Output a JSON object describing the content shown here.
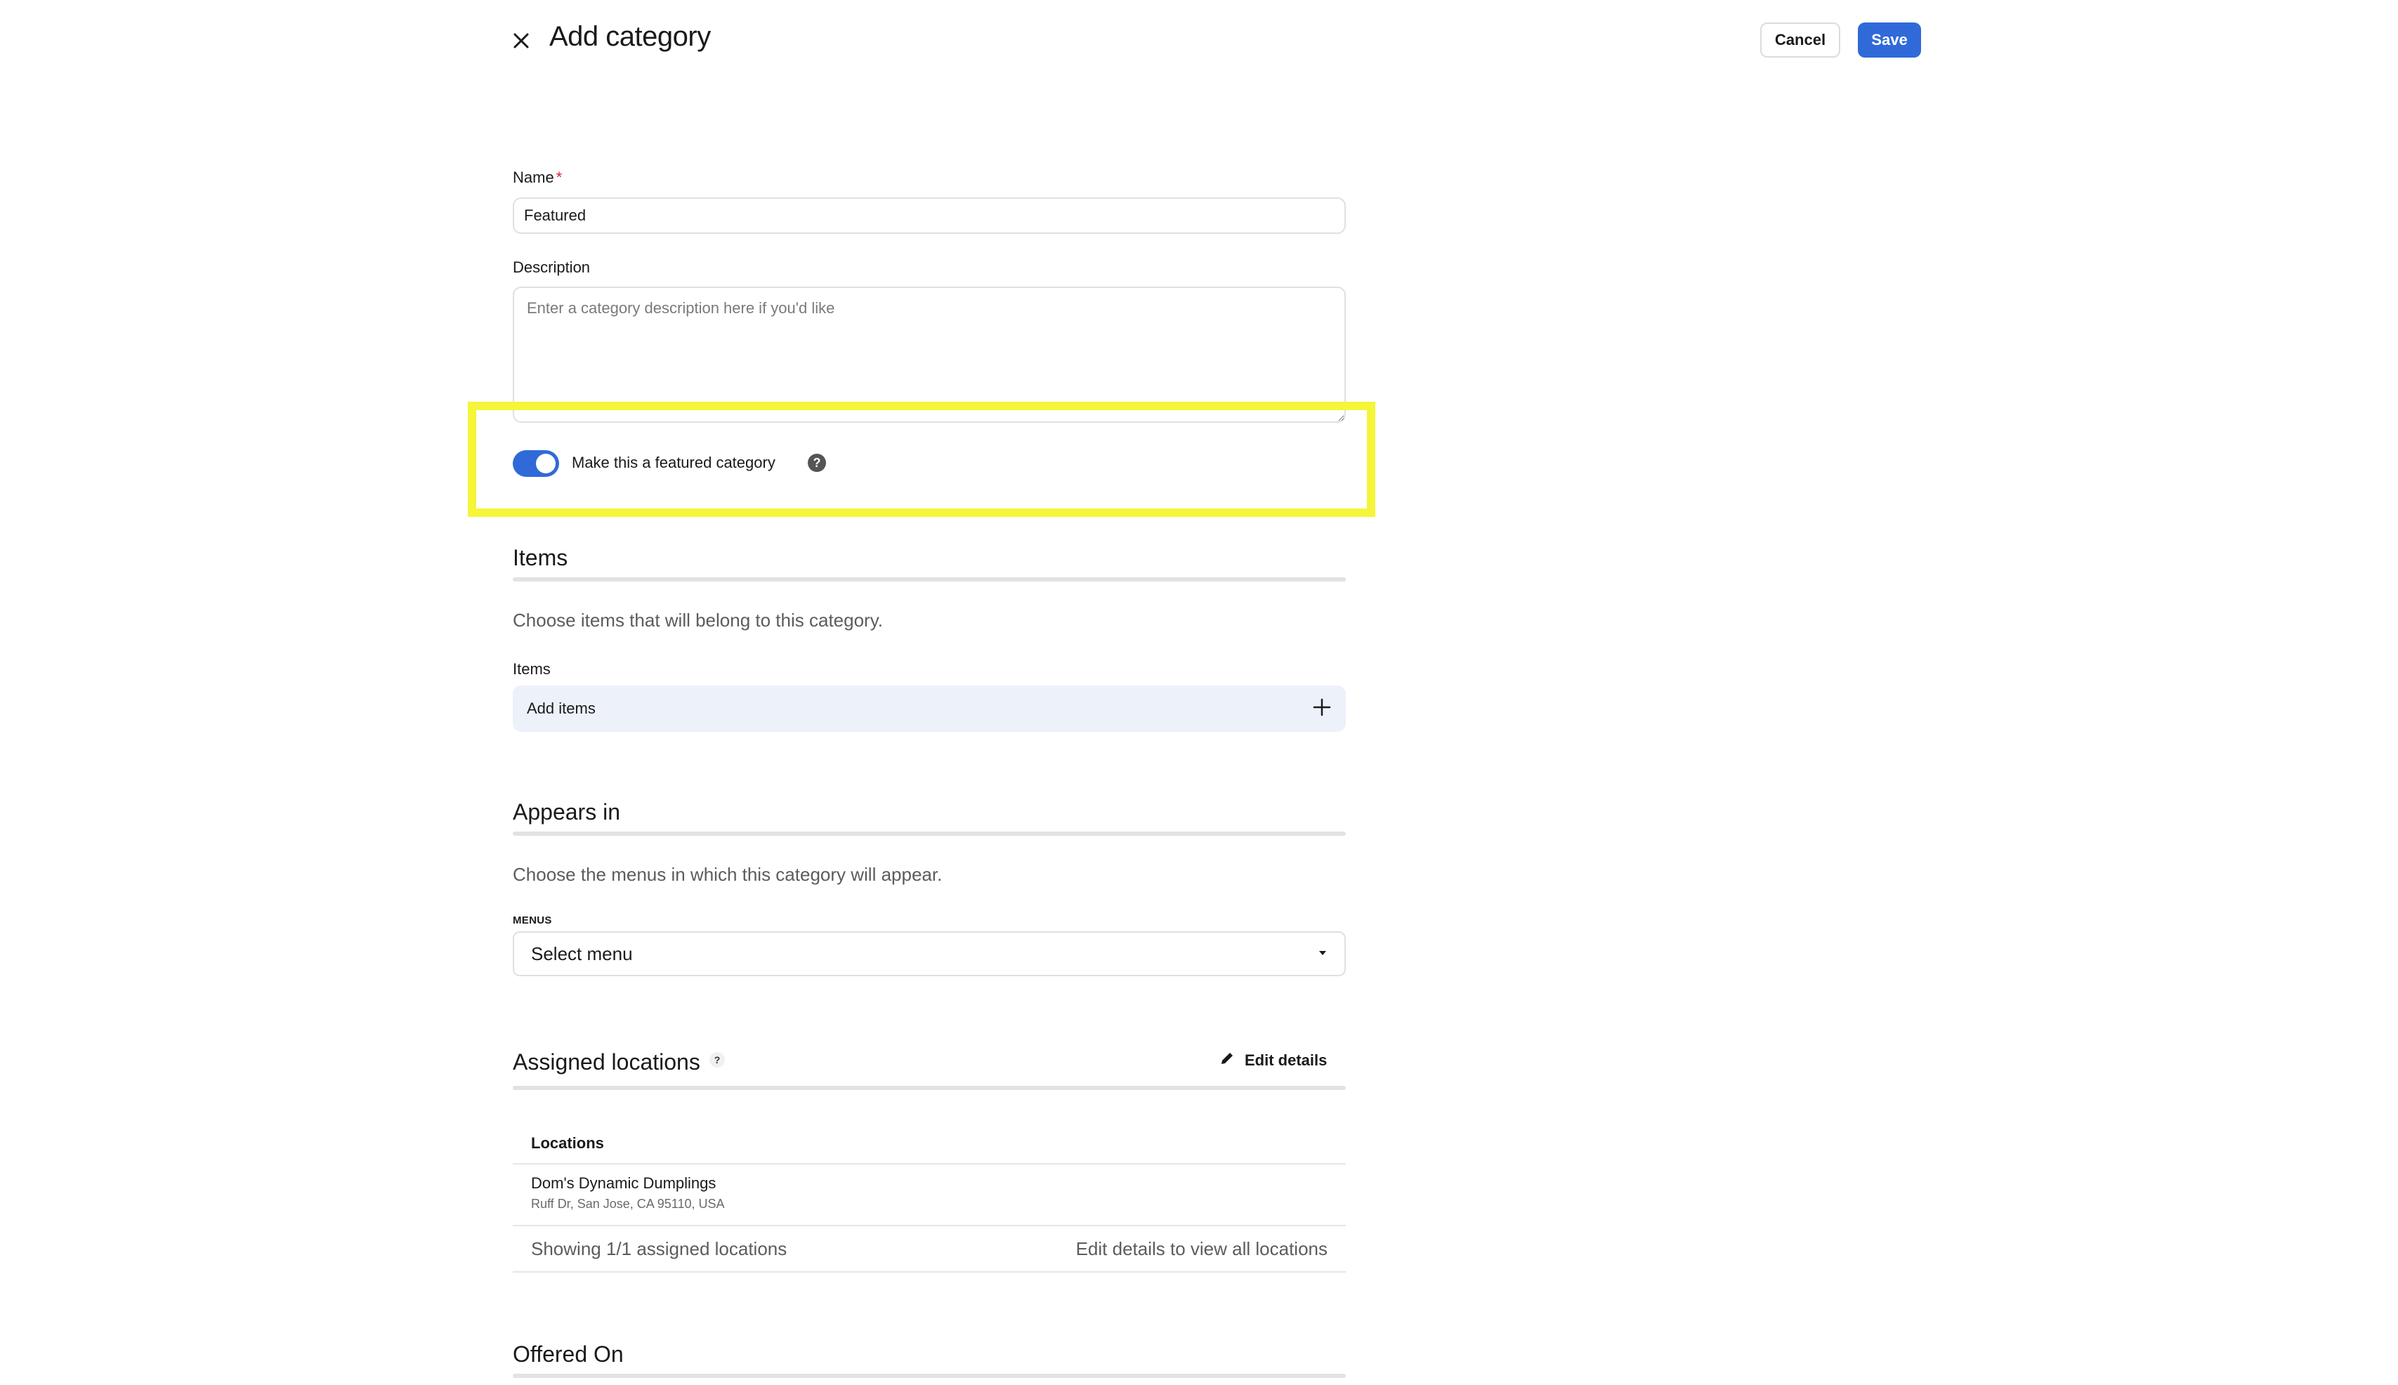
{
  "header": {
    "title": "Add category",
    "cancel_label": "Cancel",
    "save_label": "Save"
  },
  "form": {
    "name_label": "Name",
    "required_mark": "*",
    "name_value": "Featured",
    "description_label": "Description",
    "description_placeholder": "Enter a category description here if you'd like",
    "featured_toggle_label": "Make this a featured category",
    "featured_toggle_on": true,
    "help_glyph": "?"
  },
  "items_section": {
    "title": "Items",
    "description": "Choose items that will belong to this category.",
    "field_label": "Items",
    "add_label": "Add items"
  },
  "appears_in": {
    "title": "Appears in",
    "description": "Choose the menus in which this category will appear.",
    "menus_label": "MENUS",
    "select_value": "Select menu"
  },
  "assigned_locations": {
    "title": "Assigned locations",
    "help_glyph": "?",
    "edit_label": "Edit details",
    "column_header": "Locations",
    "rows": [
      {
        "name": "Dom's Dynamic Dumplings",
        "address": "Ruff Dr, San Jose, CA 95110, USA"
      }
    ],
    "footer_count": "Showing 1/1 assigned locations",
    "footer_hint": "Edit details to view all locations"
  },
  "offered_on": {
    "title": "Offered On"
  },
  "colors": {
    "accent": "#2f6ad8",
    "highlight": "#f5f53a",
    "add_items_bg": "#edf1fa"
  },
  "icons": {
    "close": "close-icon",
    "help": "help-circle-icon",
    "plus": "plus-icon",
    "dropdown": "caret-down-icon",
    "edit": "pencil-icon"
  }
}
